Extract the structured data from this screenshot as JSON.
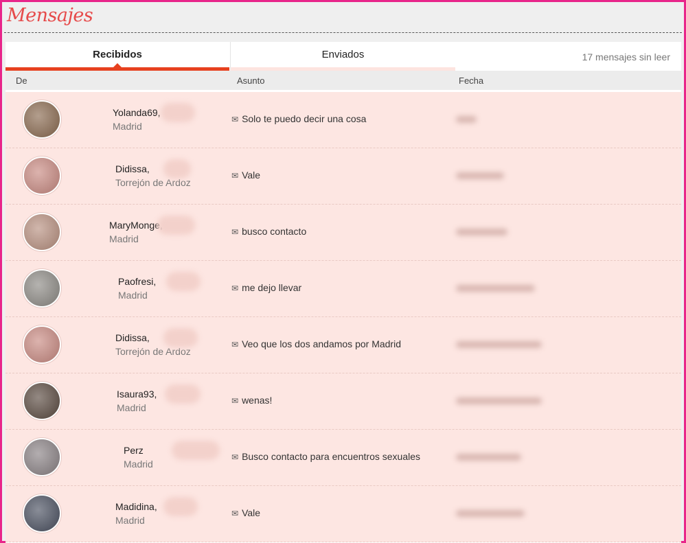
{
  "header": {
    "title": "Mensajes"
  },
  "tabs": [
    {
      "label": "Recibidos",
      "active": true
    },
    {
      "label": "Enviados",
      "active": false
    }
  ],
  "unread_text": "17 mensajes sin leer",
  "columns": {
    "from": "De",
    "subject": "Asunto",
    "date": "Fecha"
  },
  "icons": {
    "envelope": "envelope-icon"
  },
  "colors": {
    "accent": "#e7411f",
    "row_bg": "#fde6e2",
    "border": "#e8258a",
    "title": "#e64a4a"
  },
  "messages": [
    {
      "name": "Yolanda69,",
      "city": "Madrid",
      "subject": "Solo te puedo decir una cosa",
      "avatar_color": "#8a6a50"
    },
    {
      "name": "Didissa,",
      "city": "Torrejón de Ardoz",
      "subject": "Vale",
      "avatar_color": "#c98a82"
    },
    {
      "name": "MaryMonge,",
      "city": "Madrid",
      "subject": "busco contacto",
      "avatar_color": "#b89080"
    },
    {
      "name": "Paofresi,",
      "city": "Madrid",
      "subject": "me dejo llevar",
      "avatar_color": "#8d8a85"
    },
    {
      "name": "Didissa,",
      "city": "Torrejón de Ardoz",
      "subject": "Veo que los dos andamos por Madrid",
      "avatar_color": "#c98a82"
    },
    {
      "name": "Isaura93,",
      "city": "Madrid",
      "subject": "wenas!",
      "avatar_color": "#5a4a40"
    },
    {
      "name": "Perz",
      "city": "Madrid",
      "subject": "Busco contacto para encuentros sexuales",
      "avatar_color": "#8a8285"
    },
    {
      "name": "Madidina,",
      "city": "Madrid",
      "subject": "Vale",
      "avatar_color": "#4a5060"
    }
  ]
}
